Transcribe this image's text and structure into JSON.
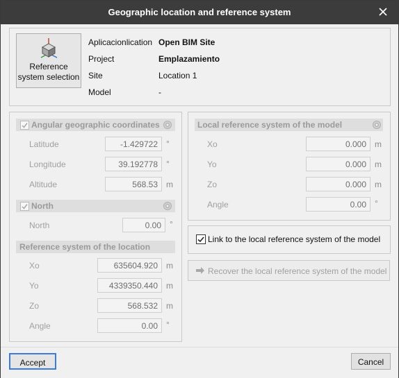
{
  "window": {
    "title": "Geographic location and reference system"
  },
  "ref_button": {
    "label_line1": "Reference",
    "label_line2": "system selection"
  },
  "info": {
    "application_label": "Aplicacionlication",
    "application_value": "Open BIM Site",
    "project_label": "Project",
    "project_value": "Emplazamiento",
    "site_label": "Site",
    "site_value": "Location 1",
    "model_label": "Model",
    "model_value": "-"
  },
  "angular": {
    "header": "Angular geographic coordinates",
    "checked": true,
    "latitude_label": "Latitude",
    "latitude_value": "-1.429722",
    "latitude_unit": "°",
    "longitude_label": "Longitude",
    "longitude_value": "39.192778",
    "longitude_unit": "°",
    "altitude_label": "Altitude",
    "altitude_value": "568.53",
    "altitude_unit": "m"
  },
  "north": {
    "header": "North",
    "checked": true,
    "label": "North",
    "value": "0.00",
    "unit": "°"
  },
  "location_ref": {
    "header": "Reference system of the location",
    "xo_label": "Xo",
    "xo_value": "635604.920",
    "xo_unit": "m",
    "yo_label": "Yo",
    "yo_value": "4339350.440",
    "yo_unit": "m",
    "zo_label": "Zo",
    "zo_value": "568.532",
    "zo_unit": "m",
    "angle_label": "Angle",
    "angle_value": "0.00",
    "angle_unit": "°"
  },
  "local_ref": {
    "header": "Local reference system of the model",
    "xo_label": "Xo",
    "xo_value": "0.000",
    "xo_unit": "m",
    "yo_label": "Yo",
    "yo_value": "0.000",
    "yo_unit": "m",
    "zo_label": "Zo",
    "zo_value": "0.000",
    "zo_unit": "m",
    "angle_label": "Angle",
    "angle_value": "0.00",
    "angle_unit": "°"
  },
  "link": {
    "label": "Link to the local reference system of the model",
    "checked": true
  },
  "recover": {
    "label": "Recover the local reference system of the model"
  },
  "footer": {
    "accept_label": "Accept",
    "cancel_label": "Cancel"
  },
  "colors": {
    "titlebar": "#3c3c3c",
    "panel": "#f0f0f0",
    "disabled_text": "#a0a0a0"
  }
}
